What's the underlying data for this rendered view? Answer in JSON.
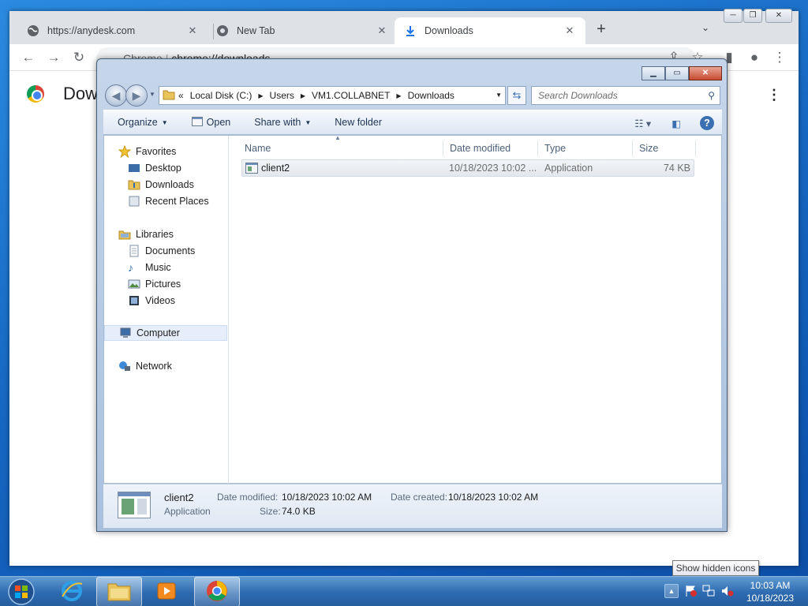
{
  "chrome": {
    "tabs": [
      {
        "title": "https://anydesk.com",
        "icon": "globe-icon"
      },
      {
        "title": "New Tab",
        "icon": "chrome-icon"
      },
      {
        "title": "Downloads",
        "icon": "download-icon"
      }
    ],
    "new_tab": "+",
    "omnibox_chip": "Chrome",
    "omnibox_url": "chrome://downloads",
    "page_title": "Downloads"
  },
  "explorer": {
    "address": [
      "«",
      "Local Disk (C:)",
      "Users",
      "VM1.COLLABNET",
      "Downloads"
    ],
    "search_placeholder": "Search Downloads",
    "commands": {
      "organize": "Organize",
      "open": "Open",
      "share": "Share with",
      "new_folder": "New folder"
    },
    "nav": {
      "favorites": "Favorites",
      "desktop": "Desktop",
      "downloads": "Downloads",
      "recent": "Recent Places",
      "libraries": "Libraries",
      "documents": "Documents",
      "music": "Music",
      "pictures": "Pictures",
      "videos": "Videos",
      "computer": "Computer",
      "network": "Network"
    },
    "columns": {
      "name": "Name",
      "date": "Date modified",
      "type": "Type",
      "size": "Size"
    },
    "files": [
      {
        "name": "client2",
        "date": "10/18/2023 10:02 ...",
        "type": "Application",
        "size": "74 KB"
      }
    ],
    "details": {
      "name": "client2",
      "kind": "Application",
      "date_modified_label": "Date modified:",
      "date_modified": "10/18/2023 10:02 AM",
      "size_label": "Size:",
      "size": "74.0 KB",
      "date_created_label": "Date created:",
      "date_created": "10/18/2023 10:02 AM"
    }
  },
  "taskbar": {
    "time": "10:03 AM",
    "date": "10/18/2023",
    "tooltip": "Show hidden icons"
  }
}
